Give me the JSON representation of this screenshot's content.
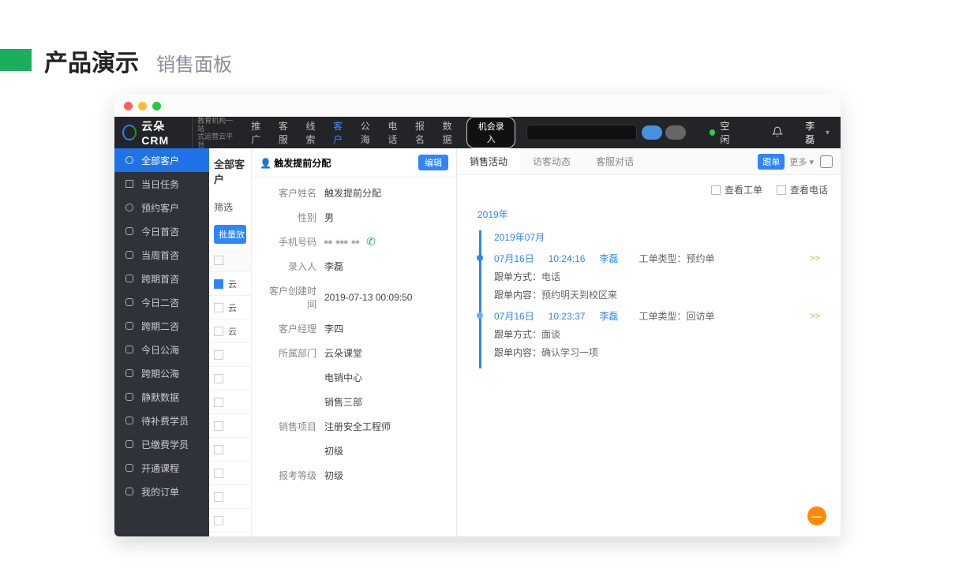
{
  "slide": {
    "title": "产品演示",
    "subtitle": "销售面板"
  },
  "logo": {
    "name": "云朵CRM",
    "sub1": "教育机构一站",
    "sub2": "式运营云平台"
  },
  "nav": {
    "items": [
      "推广",
      "客服",
      "线索",
      "客户",
      "公海",
      "电话",
      "报名",
      "数据"
    ],
    "active_index": 3,
    "record": "机会录入"
  },
  "topbar": {
    "status": "空闲",
    "user": "李磊",
    "bell": "🔔"
  },
  "sidebar": {
    "items": [
      "全部客户",
      "当日任务",
      "预约客户",
      "今日首咨",
      "当周首咨",
      "跨期首咨",
      "今日二咨",
      "跨期二咨",
      "今日公海",
      "跨期公海",
      "静默数据",
      "待补费学员",
      "已缴费学员",
      "开通课程",
      "我的订单"
    ],
    "active_index": 0
  },
  "list": {
    "title": "全部客户",
    "filter_label": "筛选",
    "batch": "批量放",
    "col": "云",
    "rows": [
      "云",
      "云",
      "",
      "",
      "",
      "",
      "",
      "",
      "",
      "",
      ""
    ]
  },
  "detail": {
    "person_icon": "👤",
    "title": "触发提前分配",
    "edit": "编辑",
    "fields": {
      "name_label": "客户姓名",
      "name": "触发提前分配",
      "gender_label": "性别",
      "gender": "男",
      "phone_label": "手机号码",
      "phone": "•• ••• ••",
      "entry_label": "录入人",
      "entry": "李磊",
      "create_label": "客户创建时间",
      "create": "2019-07-13 00:09:50",
      "mgr_label": "客户经理",
      "mgr": "李四",
      "dept_label": "所属部门",
      "dept": "云朵课堂",
      "dept2": "电销中心",
      "dept3": "销售三部",
      "proj_label": "销售项目",
      "proj": "注册安全工程师",
      "proj2": "初级",
      "grade_label": "报考等级",
      "grade": "初级"
    }
  },
  "activity": {
    "tabs": [
      "销售活动",
      "访客动态",
      "客服对话"
    ],
    "active_index": 0,
    "follow_tag": "跟单",
    "more": "更多 ▾",
    "filters": {
      "orders": "查看工单",
      "calls": "查看电话"
    },
    "year": "2019年",
    "month": "2019年07月",
    "entries": [
      {
        "date": "07月16日",
        "time": "10:24:16",
        "user": "李磊",
        "type_label": "工单类型：",
        "type": "预约单",
        "method_label": "跟单方式：",
        "method": "电话",
        "content_label": "跟单内容：",
        "content": "预约明天到校区来",
        "more": ">>"
      },
      {
        "date": "07月16日",
        "time": "10:23:37",
        "user": "李磊",
        "type_label": "工单类型：",
        "type": "回访单",
        "method_label": "跟单方式：",
        "method": "面谈",
        "content_label": "跟单内容：",
        "content": "确认学习一项",
        "more": ">>"
      }
    ]
  },
  "fab": "—"
}
